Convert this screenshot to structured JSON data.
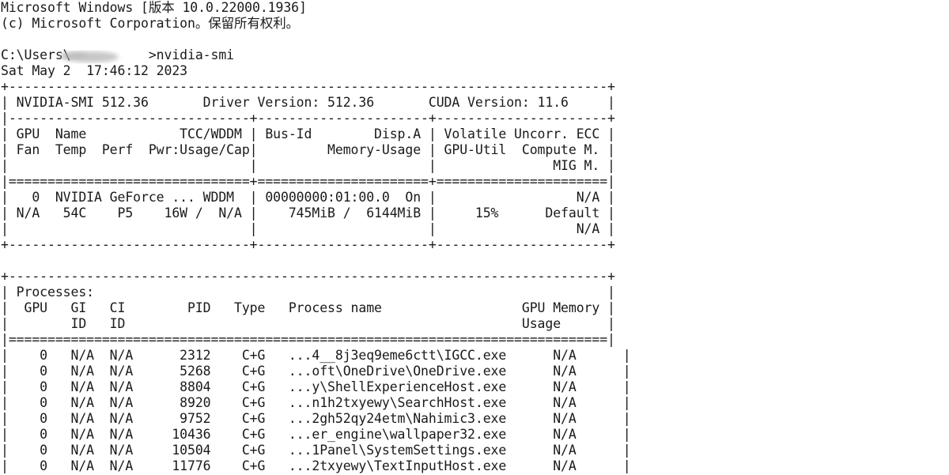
{
  "window": {
    "header": [
      "Microsoft Windows [版本 10.0.22000.1936]",
      "(c) Microsoft Corporation。保留所有权利。"
    ],
    "prompt": "C:\\Users\\          >nvidia-smi",
    "date": "Sat May 2  17:46:12 2023"
  },
  "gpu_table": {
    "border_top": "+-----------------------------------------------------------------------------+",
    "info_line": "| NVIDIA-SMI 512.36       Driver Version: 512.36       CUDA Version: 11.6     |",
    "sep_dash": "|-------------------------------+----------------------+----------------------+",
    "head1": "| GPU  Name            TCC/WDDM | Bus-Id        Disp.A | Volatile Uncorr. ECC |",
    "head2": "| Fan  Temp  Perf  Pwr:Usage/Cap|         Memory-Usage | GPU-Util  Compute M. |",
    "head3": "|                               |                      |               MIG M. |",
    "sep_eq": "|===============================+======================+======================|",
    "row1": "|   0  NVIDIA GeForce ... WDDM  | 00000000:01:00.0  On |                  N/A |",
    "row2": "| N/A   54C    P5    16W /  N/A |    745MiB /  6144MiB |     15%      Default |",
    "row3": "|                               |                      |                  N/A |",
    "border_bottom": "+-------------------------------+----------------------+----------------------+"
  },
  "process_table": {
    "border_top": "+-----------------------------------------------------------------------------+",
    "title": "| Processes:                                                                  |",
    "head1": "|  GPU   GI   CI        PID   Type   Process name                  GPU Memory |",
    "head2": "|        ID   ID                                                   Usage      |",
    "sep_eq": "|=============================================================================|",
    "rows": [
      "|    0   N/A  N/A      2312    C+G   ...4__8j3eq9eme6ctt\\IGCC.exe      N/A      |",
      "|    0   N/A  N/A      5268    C+G   ...oft\\OneDrive\\OneDrive.exe      N/A      |",
      "|    0   N/A  N/A      8804    C+G   ...y\\ShellExperienceHost.exe      N/A      |",
      "|    0   N/A  N/A      8920    C+G   ...n1h2txyewy\\SearchHost.exe      N/A      |",
      "|    0   N/A  N/A      9752    C+G   ...2gh52qy24etm\\Nahimic3.exe      N/A      |",
      "|    0   N/A  N/A     10436    C+G   ...er_engine\\wallpaper32.exe      N/A      |",
      "|    0   N/A  N/A     10504    C+G   ...1Panel\\SystemSettings.exe      N/A      |",
      "|    0   N/A  N/A     11776    C+G   ...2txyewy\\TextInputHost.exe      N/A      |"
    ]
  }
}
